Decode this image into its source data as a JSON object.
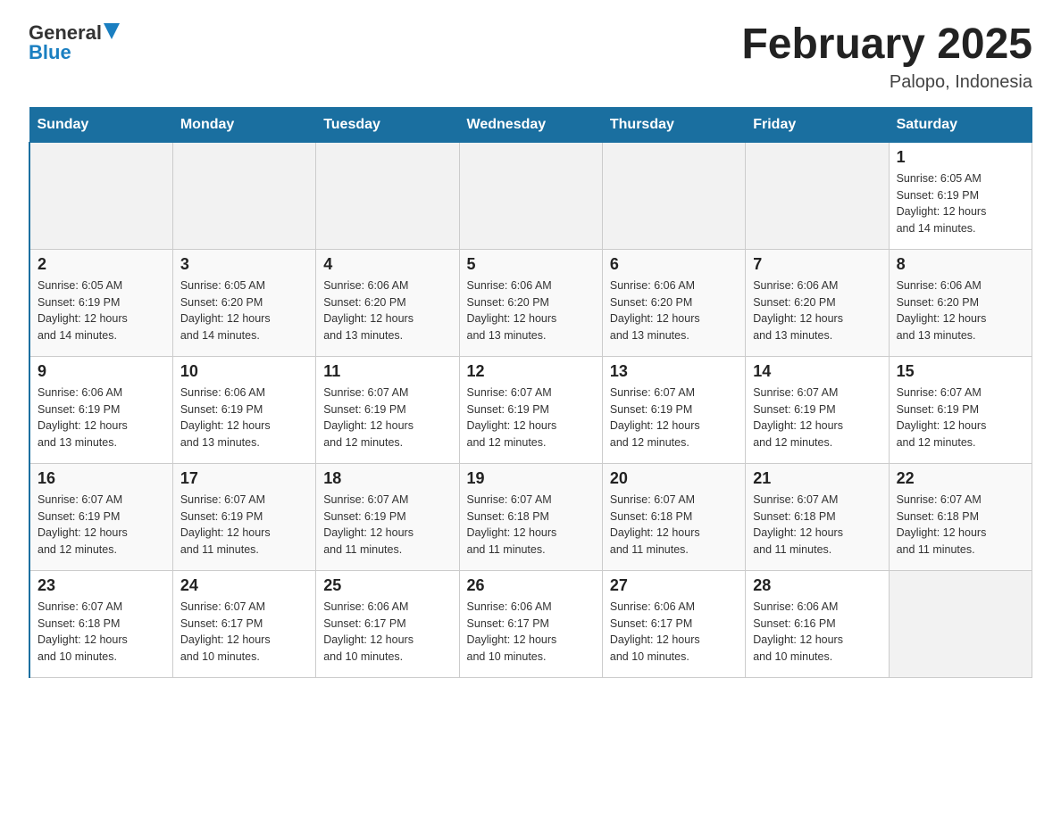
{
  "header": {
    "logo_general": "General",
    "logo_blue": "Blue",
    "month_title": "February 2025",
    "location": "Palopo, Indonesia"
  },
  "days_of_week": [
    "Sunday",
    "Monday",
    "Tuesday",
    "Wednesday",
    "Thursday",
    "Friday",
    "Saturday"
  ],
  "weeks": [
    [
      {
        "day": "",
        "info": ""
      },
      {
        "day": "",
        "info": ""
      },
      {
        "day": "",
        "info": ""
      },
      {
        "day": "",
        "info": ""
      },
      {
        "day": "",
        "info": ""
      },
      {
        "day": "",
        "info": ""
      },
      {
        "day": "1",
        "info": "Sunrise: 6:05 AM\nSunset: 6:19 PM\nDaylight: 12 hours\nand 14 minutes."
      }
    ],
    [
      {
        "day": "2",
        "info": "Sunrise: 6:05 AM\nSunset: 6:19 PM\nDaylight: 12 hours\nand 14 minutes."
      },
      {
        "day": "3",
        "info": "Sunrise: 6:05 AM\nSunset: 6:20 PM\nDaylight: 12 hours\nand 14 minutes."
      },
      {
        "day": "4",
        "info": "Sunrise: 6:06 AM\nSunset: 6:20 PM\nDaylight: 12 hours\nand 13 minutes."
      },
      {
        "day": "5",
        "info": "Sunrise: 6:06 AM\nSunset: 6:20 PM\nDaylight: 12 hours\nand 13 minutes."
      },
      {
        "day": "6",
        "info": "Sunrise: 6:06 AM\nSunset: 6:20 PM\nDaylight: 12 hours\nand 13 minutes."
      },
      {
        "day": "7",
        "info": "Sunrise: 6:06 AM\nSunset: 6:20 PM\nDaylight: 12 hours\nand 13 minutes."
      },
      {
        "day": "8",
        "info": "Sunrise: 6:06 AM\nSunset: 6:20 PM\nDaylight: 12 hours\nand 13 minutes."
      }
    ],
    [
      {
        "day": "9",
        "info": "Sunrise: 6:06 AM\nSunset: 6:19 PM\nDaylight: 12 hours\nand 13 minutes."
      },
      {
        "day": "10",
        "info": "Sunrise: 6:06 AM\nSunset: 6:19 PM\nDaylight: 12 hours\nand 13 minutes."
      },
      {
        "day": "11",
        "info": "Sunrise: 6:07 AM\nSunset: 6:19 PM\nDaylight: 12 hours\nand 12 minutes."
      },
      {
        "day": "12",
        "info": "Sunrise: 6:07 AM\nSunset: 6:19 PM\nDaylight: 12 hours\nand 12 minutes."
      },
      {
        "day": "13",
        "info": "Sunrise: 6:07 AM\nSunset: 6:19 PM\nDaylight: 12 hours\nand 12 minutes."
      },
      {
        "day": "14",
        "info": "Sunrise: 6:07 AM\nSunset: 6:19 PM\nDaylight: 12 hours\nand 12 minutes."
      },
      {
        "day": "15",
        "info": "Sunrise: 6:07 AM\nSunset: 6:19 PM\nDaylight: 12 hours\nand 12 minutes."
      }
    ],
    [
      {
        "day": "16",
        "info": "Sunrise: 6:07 AM\nSunset: 6:19 PM\nDaylight: 12 hours\nand 12 minutes."
      },
      {
        "day": "17",
        "info": "Sunrise: 6:07 AM\nSunset: 6:19 PM\nDaylight: 12 hours\nand 11 minutes."
      },
      {
        "day": "18",
        "info": "Sunrise: 6:07 AM\nSunset: 6:19 PM\nDaylight: 12 hours\nand 11 minutes."
      },
      {
        "day": "19",
        "info": "Sunrise: 6:07 AM\nSunset: 6:18 PM\nDaylight: 12 hours\nand 11 minutes."
      },
      {
        "day": "20",
        "info": "Sunrise: 6:07 AM\nSunset: 6:18 PM\nDaylight: 12 hours\nand 11 minutes."
      },
      {
        "day": "21",
        "info": "Sunrise: 6:07 AM\nSunset: 6:18 PM\nDaylight: 12 hours\nand 11 minutes."
      },
      {
        "day": "22",
        "info": "Sunrise: 6:07 AM\nSunset: 6:18 PM\nDaylight: 12 hours\nand 11 minutes."
      }
    ],
    [
      {
        "day": "23",
        "info": "Sunrise: 6:07 AM\nSunset: 6:18 PM\nDaylight: 12 hours\nand 10 minutes."
      },
      {
        "day": "24",
        "info": "Sunrise: 6:07 AM\nSunset: 6:17 PM\nDaylight: 12 hours\nand 10 minutes."
      },
      {
        "day": "25",
        "info": "Sunrise: 6:06 AM\nSunset: 6:17 PM\nDaylight: 12 hours\nand 10 minutes."
      },
      {
        "day": "26",
        "info": "Sunrise: 6:06 AM\nSunset: 6:17 PM\nDaylight: 12 hours\nand 10 minutes."
      },
      {
        "day": "27",
        "info": "Sunrise: 6:06 AM\nSunset: 6:17 PM\nDaylight: 12 hours\nand 10 minutes."
      },
      {
        "day": "28",
        "info": "Sunrise: 6:06 AM\nSunset: 6:16 PM\nDaylight: 12 hours\nand 10 minutes."
      },
      {
        "day": "",
        "info": ""
      }
    ]
  ]
}
